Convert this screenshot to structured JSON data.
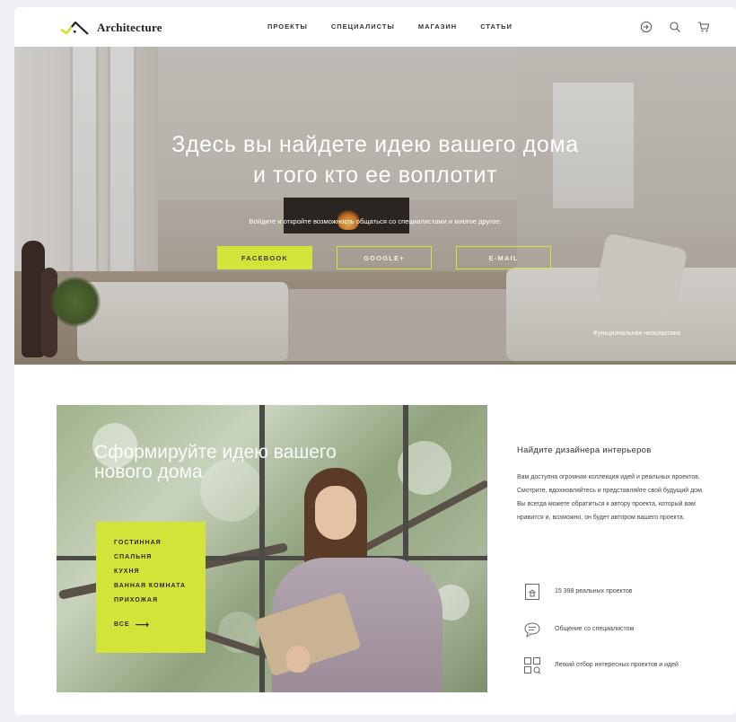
{
  "header": {
    "logo_text": "Architecture",
    "nav": [
      "ПРОЕКТЫ",
      "СПЕЦИАЛИСТЫ",
      "МАГАЗИН",
      "СТАТЬИ"
    ]
  },
  "hero": {
    "title_line1": "Здесь вы найдете идею вашего дома",
    "title_line2": "и того кто ее воплотит",
    "subtitle": "Войдите и откройте возможность общаться со специалистами и многое другое:",
    "buttons": [
      "FACEBOOK",
      "GOOGLE+",
      "E-MAIL"
    ],
    "caption": "Функциональная неоклассика"
  },
  "ideas": {
    "title": "Сформируйте идею вашего нового дома",
    "categories": [
      "ГОСТИННАЯ",
      "СПАЛЬНЯ",
      "КУХНЯ",
      "ВАННАЯ КОМНАТА",
      "ПРИХОЖАЯ"
    ],
    "all_label": "ВСЕ",
    "all_arrow": "⟶"
  },
  "designer": {
    "title": "Найдите дизайнера интерьеров",
    "text": "Вам доступна огромная коллекция идей и реальных проектов. Смотрите, вдохновляйтесь и представляйте свой будущий дом. Вы всегда можете обратиться к автору проекта, который вам нравится и, возможно, он будет автором вашего проекта.",
    "features": [
      {
        "icon": "house-icon",
        "text": "15 398 реальных проектов"
      },
      {
        "icon": "chat-icon",
        "text": "Общение со специалистом"
      },
      {
        "icon": "grid-icon",
        "text": "Легкий отбор интересных проектов и идей"
      }
    ]
  },
  "colors": {
    "accent": "#d4e33a",
    "text": "#2a2a2a",
    "background": "#eef0f3"
  }
}
